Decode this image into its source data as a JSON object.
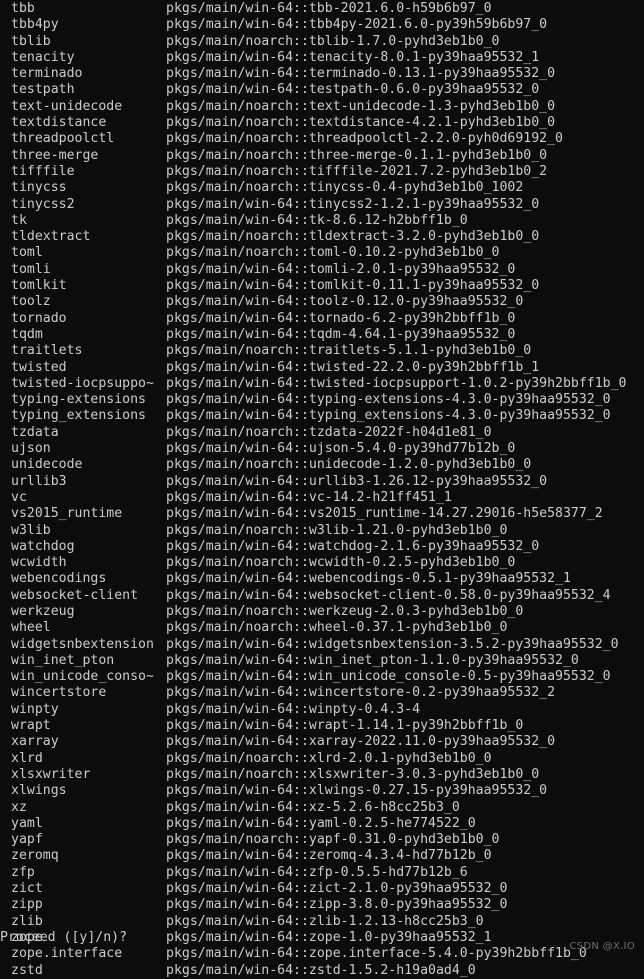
{
  "terminal": {
    "background_color": "#0c0c0c",
    "text_color": "#cccccc",
    "prompt": "Proceed ([y]/n)?",
    "watermark": "CSDN @X.IO"
  },
  "packages": [
    {
      "name": "tbb",
      "spec": "pkgs/main/win-64::tbb-2021.6.0-h59b6b97_0"
    },
    {
      "name": "tbb4py",
      "spec": "pkgs/main/win-64::tbb4py-2021.6.0-py39h59b6b97_0"
    },
    {
      "name": "tblib",
      "spec": "pkgs/main/noarch::tblib-1.7.0-pyhd3eb1b0_0"
    },
    {
      "name": "tenacity",
      "spec": "pkgs/main/win-64::tenacity-8.0.1-py39haa95532_1"
    },
    {
      "name": "terminado",
      "spec": "pkgs/main/win-64::terminado-0.13.1-py39haa95532_0"
    },
    {
      "name": "testpath",
      "spec": "pkgs/main/win-64::testpath-0.6.0-py39haa95532_0"
    },
    {
      "name": "text-unidecode",
      "spec": "pkgs/main/noarch::text-unidecode-1.3-pyhd3eb1b0_0"
    },
    {
      "name": "textdistance",
      "spec": "pkgs/main/noarch::textdistance-4.2.1-pyhd3eb1b0_0"
    },
    {
      "name": "threadpoolctl",
      "spec": "pkgs/main/noarch::threadpoolctl-2.2.0-pyh0d69192_0"
    },
    {
      "name": "three-merge",
      "spec": "pkgs/main/noarch::three-merge-0.1.1-pyhd3eb1b0_0"
    },
    {
      "name": "tifffile",
      "spec": "pkgs/main/noarch::tifffile-2021.7.2-pyhd3eb1b0_2"
    },
    {
      "name": "tinycss",
      "spec": "pkgs/main/noarch::tinycss-0.4-pyhd3eb1b0_1002"
    },
    {
      "name": "tinycss2",
      "spec": "pkgs/main/win-64::tinycss2-1.2.1-py39haa95532_0"
    },
    {
      "name": "tk",
      "spec": "pkgs/main/win-64::tk-8.6.12-h2bbff1b_0"
    },
    {
      "name": "tldextract",
      "spec": "pkgs/main/noarch::tldextract-3.2.0-pyhd3eb1b0_0"
    },
    {
      "name": "toml",
      "spec": "pkgs/main/noarch::toml-0.10.2-pyhd3eb1b0_0"
    },
    {
      "name": "tomli",
      "spec": "pkgs/main/win-64::tomli-2.0.1-py39haa95532_0"
    },
    {
      "name": "tomlkit",
      "spec": "pkgs/main/win-64::tomlkit-0.11.1-py39haa95532_0"
    },
    {
      "name": "toolz",
      "spec": "pkgs/main/win-64::toolz-0.12.0-py39haa95532_0"
    },
    {
      "name": "tornado",
      "spec": "pkgs/main/win-64::tornado-6.2-py39h2bbff1b_0"
    },
    {
      "name": "tqdm",
      "spec": "pkgs/main/win-64::tqdm-4.64.1-py39haa95532_0"
    },
    {
      "name": "traitlets",
      "spec": "pkgs/main/noarch::traitlets-5.1.1-pyhd3eb1b0_0"
    },
    {
      "name": "twisted",
      "spec": "pkgs/main/win-64::twisted-22.2.0-py39h2bbff1b_1"
    },
    {
      "name": "twisted-iocpsuppo~",
      "spec": "pkgs/main/win-64::twisted-iocpsupport-1.0.2-py39h2bbff1b_0"
    },
    {
      "name": "typing-extensions",
      "spec": "pkgs/main/win-64::typing-extensions-4.3.0-py39haa95532_0"
    },
    {
      "name": "typing_extensions",
      "spec": "pkgs/main/win-64::typing_extensions-4.3.0-py39haa95532_0"
    },
    {
      "name": "tzdata",
      "spec": "pkgs/main/noarch::tzdata-2022f-h04d1e81_0"
    },
    {
      "name": "ujson",
      "spec": "pkgs/main/win-64::ujson-5.4.0-py39hd77b12b_0"
    },
    {
      "name": "unidecode",
      "spec": "pkgs/main/noarch::unidecode-1.2.0-pyhd3eb1b0_0"
    },
    {
      "name": "urllib3",
      "spec": "pkgs/main/win-64::urllib3-1.26.12-py39haa95532_0"
    },
    {
      "name": "vc",
      "spec": "pkgs/main/win-64::vc-14.2-h21ff451_1"
    },
    {
      "name": "vs2015_runtime",
      "spec": "pkgs/main/win-64::vs2015_runtime-14.27.29016-h5e58377_2"
    },
    {
      "name": "w3lib",
      "spec": "pkgs/main/noarch::w3lib-1.21.0-pyhd3eb1b0_0"
    },
    {
      "name": "watchdog",
      "spec": "pkgs/main/win-64::watchdog-2.1.6-py39haa95532_0"
    },
    {
      "name": "wcwidth",
      "spec": "pkgs/main/noarch::wcwidth-0.2.5-pyhd3eb1b0_0"
    },
    {
      "name": "webencodings",
      "spec": "pkgs/main/win-64::webencodings-0.5.1-py39haa95532_1"
    },
    {
      "name": "websocket-client",
      "spec": "pkgs/main/win-64::websocket-client-0.58.0-py39haa95532_4"
    },
    {
      "name": "werkzeug",
      "spec": "pkgs/main/noarch::werkzeug-2.0.3-pyhd3eb1b0_0"
    },
    {
      "name": "wheel",
      "spec": "pkgs/main/noarch::wheel-0.37.1-pyhd3eb1b0_0"
    },
    {
      "name": "widgetsnbextension",
      "spec": "pkgs/main/win-64::widgetsnbextension-3.5.2-py39haa95532_0"
    },
    {
      "name": "win_inet_pton",
      "spec": "pkgs/main/win-64::win_inet_pton-1.1.0-py39haa95532_0"
    },
    {
      "name": "win_unicode_conso~",
      "spec": "pkgs/main/win-64::win_unicode_console-0.5-py39haa95532_0"
    },
    {
      "name": "wincertstore",
      "spec": "pkgs/main/win-64::wincertstore-0.2-py39haa95532_2"
    },
    {
      "name": "winpty",
      "spec": "pkgs/main/win-64::winpty-0.4.3-4"
    },
    {
      "name": "wrapt",
      "spec": "pkgs/main/win-64::wrapt-1.14.1-py39h2bbff1b_0"
    },
    {
      "name": "xarray",
      "spec": "pkgs/main/win-64::xarray-2022.11.0-py39haa95532_0"
    },
    {
      "name": "xlrd",
      "spec": "pkgs/main/noarch::xlrd-2.0.1-pyhd3eb1b0_0"
    },
    {
      "name": "xlsxwriter",
      "spec": "pkgs/main/noarch::xlsxwriter-3.0.3-pyhd3eb1b0_0"
    },
    {
      "name": "xlwings",
      "spec": "pkgs/main/win-64::xlwings-0.27.15-py39haa95532_0"
    },
    {
      "name": "xz",
      "spec": "pkgs/main/win-64::xz-5.2.6-h8cc25b3_0"
    },
    {
      "name": "yaml",
      "spec": "pkgs/main/win-64::yaml-0.2.5-he774522_0"
    },
    {
      "name": "yapf",
      "spec": "pkgs/main/noarch::yapf-0.31.0-pyhd3eb1b0_0"
    },
    {
      "name": "zeromq",
      "spec": "pkgs/main/win-64::zeromq-4.3.4-hd77b12b_0"
    },
    {
      "name": "zfp",
      "spec": "pkgs/main/win-64::zfp-0.5.5-hd77b12b_6"
    },
    {
      "name": "zict",
      "spec": "pkgs/main/win-64::zict-2.1.0-py39haa95532_0"
    },
    {
      "name": "zipp",
      "spec": "pkgs/main/win-64::zipp-3.8.0-py39haa95532_0"
    },
    {
      "name": "zlib",
      "spec": "pkgs/main/win-64::zlib-1.2.13-h8cc25b3_0"
    },
    {
      "name": "zope",
      "spec": "pkgs/main/win-64::zope-1.0-py39haa95532_1"
    },
    {
      "name": "zope.interface",
      "spec": "pkgs/main/win-64::zope.interface-5.4.0-py39h2bbff1b_0"
    },
    {
      "name": "zstd",
      "spec": "pkgs/main/win-64::zstd-1.5.2-h19a0ad4_0"
    }
  ]
}
